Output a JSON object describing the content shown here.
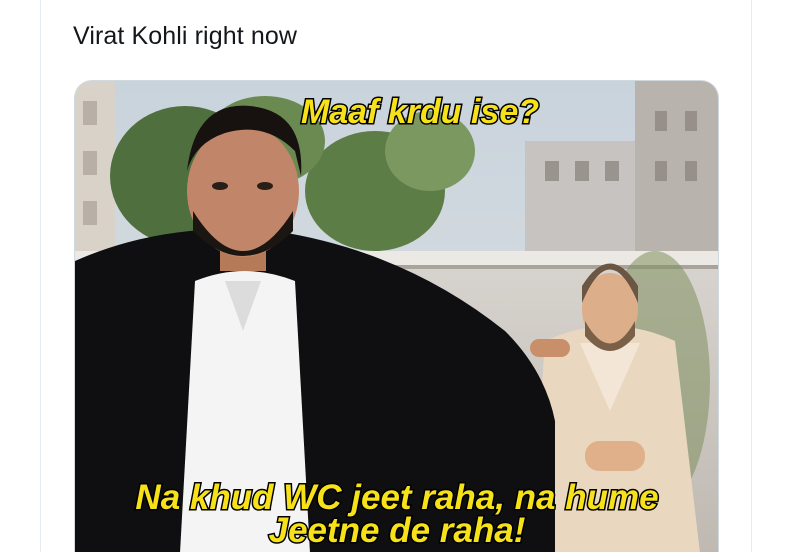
{
  "tweet": {
    "text": "Virat Kohli right now"
  },
  "meme": {
    "top_caption": "Maaf krdu ise?",
    "bottom_caption_line1": "Na khud WC jeet raha, na hume",
    "bottom_caption_line2": "Jeetne de raha!",
    "caption_color": "#f7e21a"
  }
}
